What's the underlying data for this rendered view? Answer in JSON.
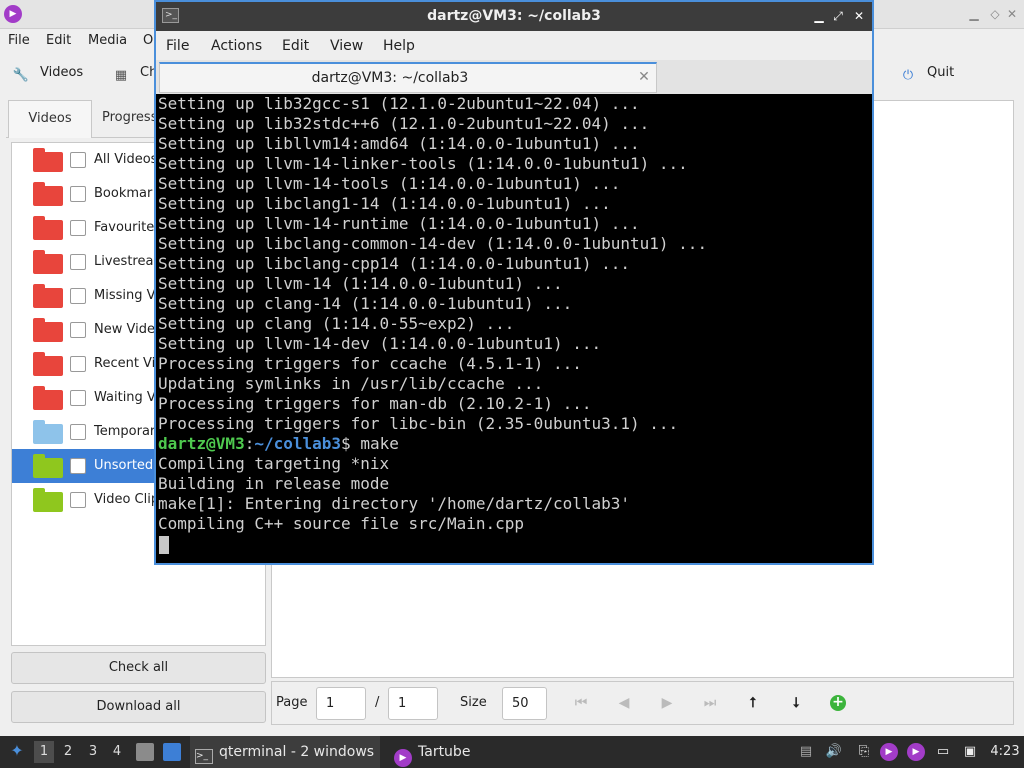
{
  "tartube": {
    "menu": [
      "File",
      "Edit",
      "Media",
      "O"
    ],
    "toolbar": {
      "videos": "Videos",
      "check": "Ch",
      "quit": "Quit"
    },
    "tabs": [
      "Videos",
      "Progress"
    ],
    "folders": [
      {
        "label": "All Videos",
        "color": "#e8453c"
      },
      {
        "label": "Bookmar",
        "color": "#e8453c"
      },
      {
        "label": "Favourite",
        "color": "#e8453c"
      },
      {
        "label": "Livestrea",
        "color": "#e8453c"
      },
      {
        "label": "Missing V",
        "color": "#e8453c"
      },
      {
        "label": "New Vide",
        "color": "#e8453c"
      },
      {
        "label": "Recent Vi",
        "color": "#e8453c"
      },
      {
        "label": "Waiting V",
        "color": "#e8453c"
      },
      {
        "label": "Temporar",
        "color": "#8ec3ea"
      },
      {
        "label": "Unsorted",
        "color": "#8fc71e",
        "selected": true
      },
      {
        "label": "Video Clip",
        "color": "#8fc71e"
      }
    ],
    "check_all": "Check all",
    "download_all": "Download all",
    "pager": {
      "page_label": "Page",
      "page_value": "1",
      "sep": "/",
      "total_pages": "1",
      "size_label": "Size",
      "size_value": "50"
    }
  },
  "terminal": {
    "title": "dartz@VM3: ~/collab3",
    "menu": [
      "File",
      "Actions",
      "Edit",
      "View",
      "Help"
    ],
    "tab_label": "dartz@VM3: ~/collab3",
    "lines": [
      "Setting up lib32gcc-s1 (12.1.0-2ubuntu1~22.04) ...",
      "Setting up lib32stdc++6 (12.1.0-2ubuntu1~22.04) ...",
      "Setting up libllvm14:amd64 (1:14.0.0-1ubuntu1) ...",
      "Setting up llvm-14-linker-tools (1:14.0.0-1ubuntu1) ...",
      "Setting up llvm-14-tools (1:14.0.0-1ubuntu1) ...",
      "Setting up libclang1-14 (1:14.0.0-1ubuntu1) ...",
      "Setting up llvm-14-runtime (1:14.0.0-1ubuntu1) ...",
      "Setting up libclang-common-14-dev (1:14.0.0-1ubuntu1) ...",
      "Setting up libclang-cpp14 (1:14.0.0-1ubuntu1) ...",
      "Setting up llvm-14 (1:14.0.0-1ubuntu1) ...",
      "Setting up clang-14 (1:14.0.0-1ubuntu1) ...",
      "Setting up clang (1:14.0-55~exp2) ...",
      "Setting up llvm-14-dev (1:14.0.0-1ubuntu1) ...",
      "Processing triggers for ccache (4.5.1-1) ...",
      "Updating symlinks in /usr/lib/ccache ...",
      "Processing triggers for man-db (2.10.2-1) ...",
      "Processing triggers for libc-bin (2.35-0ubuntu3.1) ..."
    ],
    "prompt_user": "dartz@VM3",
    "prompt_sep": ":",
    "prompt_path": "~/collab3",
    "prompt_cmd": "$ make",
    "output": [
      "Compiling targeting *nix",
      "Building in release mode",
      "make[1]: Entering directory '/home/dartz/collab3'",
      "Compiling C++ source file src/Main.cpp"
    ]
  },
  "taskbar": {
    "workspaces": [
      "1",
      "2",
      "3",
      "4"
    ],
    "terminal_task": "qterminal - 2 windows",
    "tartube_task": "Tartube",
    "clock": "4:23"
  }
}
